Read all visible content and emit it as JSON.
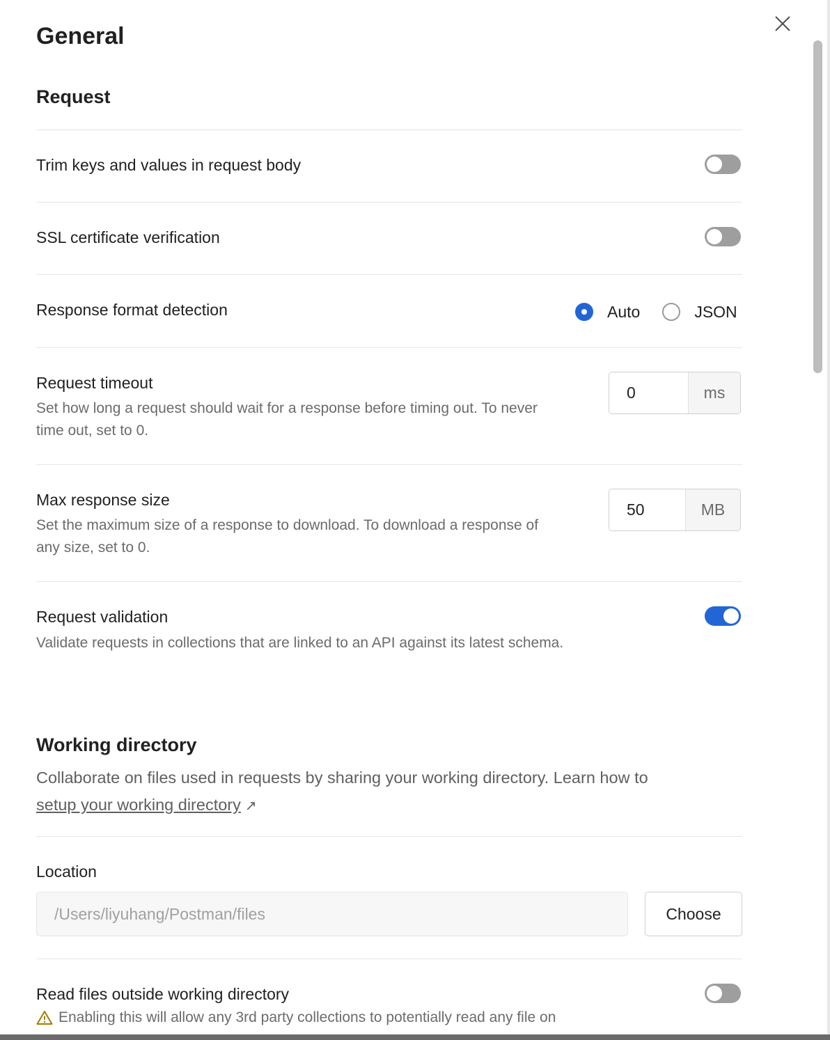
{
  "modal": {
    "title": "General"
  },
  "request": {
    "section_title": "Request",
    "trim": {
      "label": "Trim keys and values in request body",
      "enabled": false
    },
    "ssl": {
      "label": "SSL certificate verification",
      "enabled": false
    },
    "response_format": {
      "label": "Response format detection",
      "options": [
        "Auto",
        "JSON"
      ],
      "selected": "Auto"
    },
    "timeout": {
      "label": "Request timeout",
      "description": "Set how long a request should wait for a response before timing out. To never time out, set to 0.",
      "value": "0",
      "unit": "ms"
    },
    "max_size": {
      "label": "Max response size",
      "description": "Set the maximum size of a response to download. To download a response of any size, set to 0.",
      "value": "50",
      "unit": "MB"
    },
    "validation": {
      "label": "Request validation",
      "description": "Validate requests in collections that are linked to an API against its latest schema.",
      "enabled": true
    }
  },
  "working_directory": {
    "section_title": "Working directory",
    "description_prefix": "Collaborate on files used in requests by sharing your working directory. Learn how to ",
    "link_text": "setup your working directory",
    "link_icon": "↗",
    "location_label": "Location",
    "location_value": "/Users/liyuhang/Postman/files",
    "choose_label": "Choose",
    "read_outside": {
      "label": "Read files outside working directory",
      "enabled": false,
      "warning": "Enabling this will allow any 3rd party collections to potentially read any file on"
    }
  },
  "colors": {
    "accent": "#2266d6",
    "toggle_off": "#9e9e9e",
    "warning": "#a37a00"
  }
}
